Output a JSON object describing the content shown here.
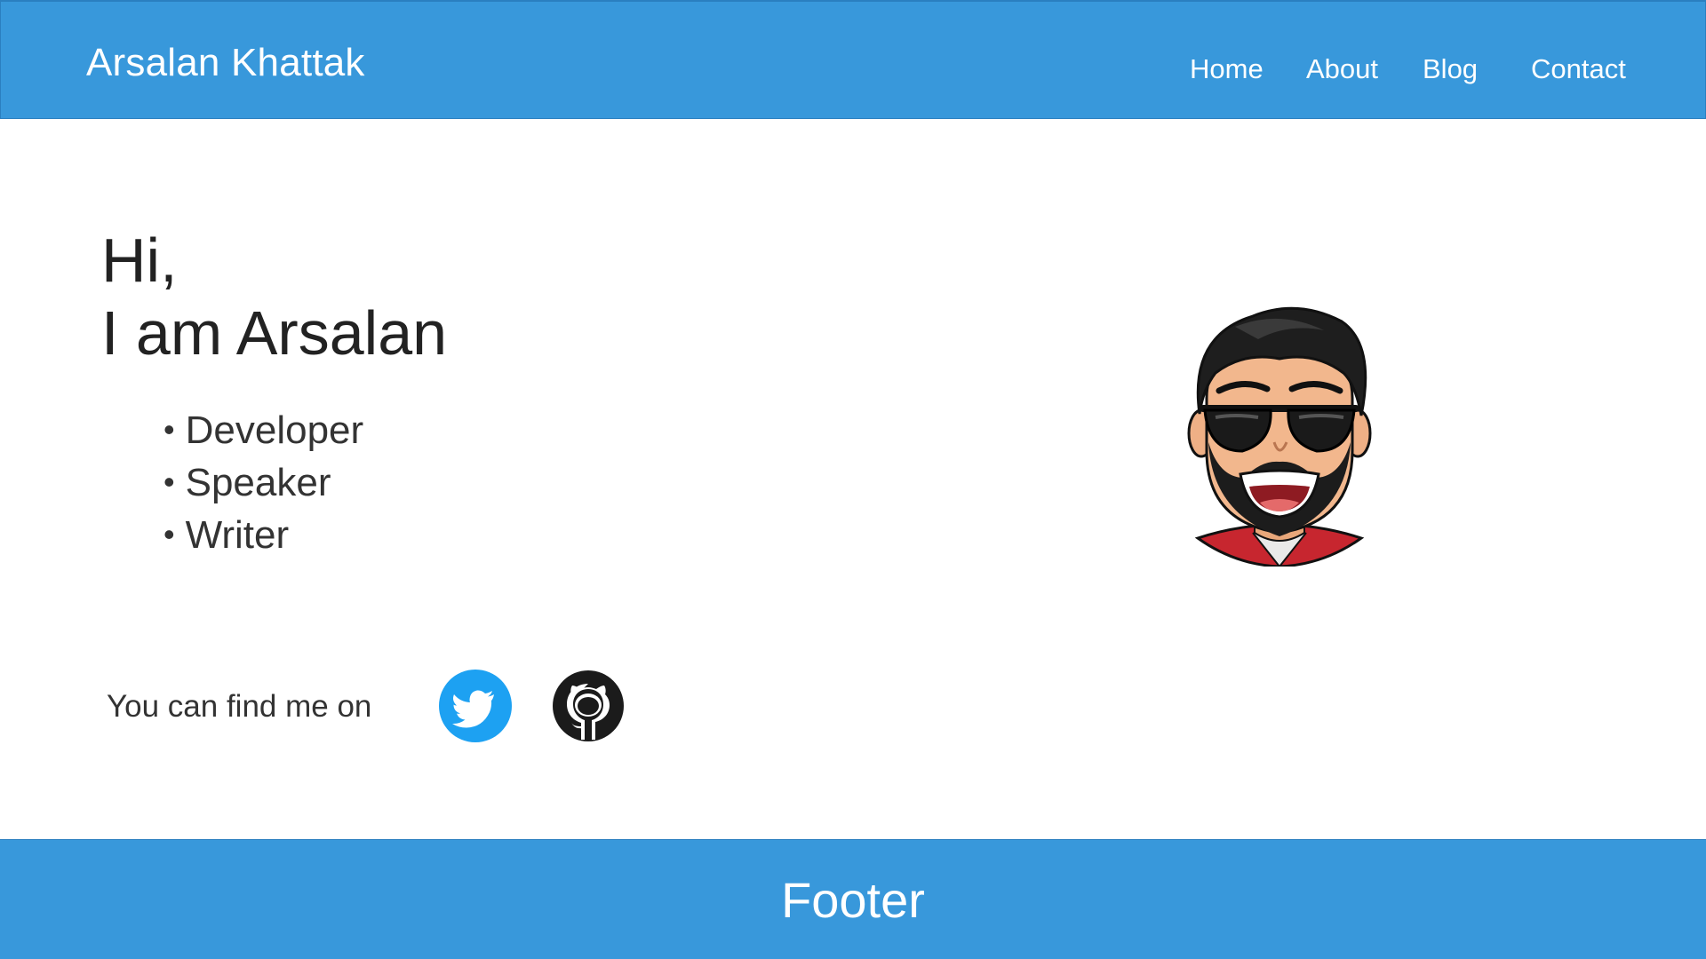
{
  "header": {
    "brand": "Arsalan Khattak",
    "nav": [
      {
        "label": "Home"
      },
      {
        "label": "About"
      },
      {
        "label": "Blog"
      },
      {
        "label": "Contact"
      }
    ]
  },
  "hero": {
    "greeting_line1": "Hi,",
    "greeting_line2": "I am Arsalan",
    "roles": [
      "Developer",
      "Speaker",
      "Writer"
    ],
    "avatar_icon": "bitmoji-avatar-icon"
  },
  "social": {
    "text": "You can find me on",
    "links": [
      {
        "icon": "twitter-icon",
        "color": "#1da1f2"
      },
      {
        "icon": "github-icon",
        "color": "#1b1b1b"
      }
    ]
  },
  "footer": {
    "text": "Footer"
  },
  "colors": {
    "brand_blue": "#3898db",
    "text_dark": "#222222"
  }
}
